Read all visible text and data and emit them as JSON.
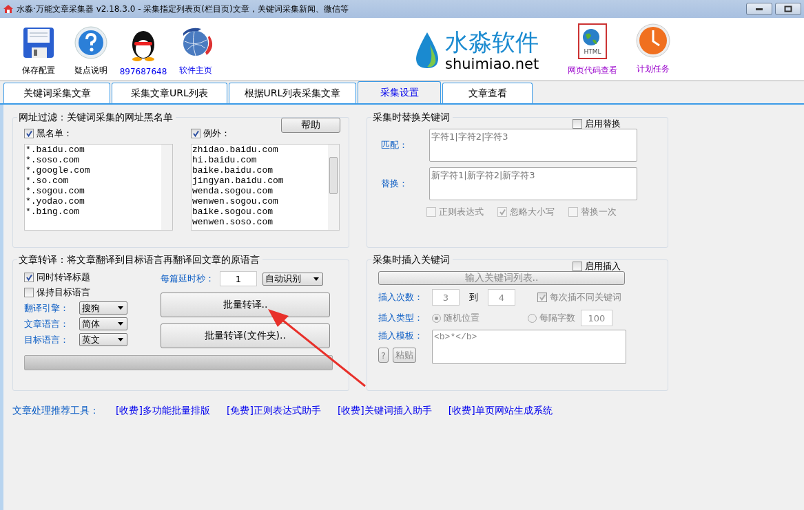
{
  "window": {
    "title": "水淼·万能文章采集器 v2.18.3.0 - 采集指定列表页(栏目页)文章，关键词采集新闻、微信等"
  },
  "toolbar": [
    {
      "label": "保存配置",
      "kind": "save",
      "link": false
    },
    {
      "label": "疑点说明",
      "kind": "help",
      "link": false
    },
    {
      "label": "897687648",
      "kind": "qq",
      "link": true
    },
    {
      "label": "软件主页",
      "kind": "web",
      "link": true
    }
  ],
  "logo": {
    "name": "水淼软件",
    "domain": "shuimiao.net"
  },
  "tools": [
    {
      "label": "网页代码查看",
      "kind": "html",
      "icon_text": "HTML"
    },
    {
      "label": "计划任务",
      "kind": "clock"
    }
  ],
  "tabs": [
    {
      "label": "关键词采集文章",
      "selected": false
    },
    {
      "label": "采集文章URL列表",
      "selected": false
    },
    {
      "label": "根据URL列表采集文章",
      "selected": false
    },
    {
      "label": "采集设置",
      "selected": true
    },
    {
      "label": "文章查看",
      "selected": false
    }
  ],
  "url_filter": {
    "title": "网址过滤：关键词采集的网址黑名单",
    "help_button": "帮助",
    "lists": [
      {
        "label": "黑名单：",
        "checked": true,
        "items": [
          "*.baidu.com",
          "*.soso.com",
          "*.google.com",
          "*.so.com",
          "*.sogou.com",
          "*.yodao.com",
          "*.bing.com"
        ]
      },
      {
        "label": "例外：",
        "checked": true,
        "items": [
          "zhidao.baidu.com",
          "hi.baidu.com",
          "baike.baidu.com",
          "jingyan.baidu.com",
          "wenda.sogou.com",
          "wenwen.sogou.com",
          "baike.sogou.com",
          "wenwen.soso.com"
        ]
      }
    ]
  },
  "replace": {
    "title": "采集时替换关键词",
    "enable": {
      "label": "启用替换",
      "checked": false
    },
    "fields": [
      {
        "label": "匹配：",
        "value": "字符1|字符2|字符3"
      },
      {
        "label": "替换：",
        "value": "新字符1|新字符2|新字符3"
      }
    ],
    "options": [
      {
        "label": "正则表达式",
        "checked": false,
        "disabled": true
      },
      {
        "label": "忽略大小写",
        "checked": true,
        "disabled": true
      },
      {
        "label": "替换一次",
        "checked": false,
        "disabled": true
      }
    ]
  },
  "translate": {
    "title": "文章转译：将文章翻译到目标语言再翻译回文章的原语言",
    "options": [
      {
        "label": "同时转译标题",
        "checked": true
      },
      {
        "label": "保持目标语言",
        "checked": false
      }
    ],
    "selects": [
      {
        "label": "翻译引擎：",
        "value": "搜狗"
      },
      {
        "label": "文章语言：",
        "value": "简体"
      },
      {
        "label": "目标语言：",
        "value": "英文"
      }
    ],
    "delay": {
      "label": "每篇延时秒：",
      "value": "1"
    },
    "detect": "自动识别",
    "buttons": [
      "批量转译..",
      "批量转译(文件夹).."
    ],
    "progress": {
      "level": 0
    }
  },
  "insert": {
    "title": "采集时插入关键词",
    "enable": {
      "label": "启用插入",
      "checked": false
    },
    "disabled": true,
    "list_button": "输入关键词列表..",
    "count": {
      "label": "插入次数：",
      "from": "3",
      "to_label": "到",
      "to": "4"
    },
    "different": {
      "label": "每次插不同关键词",
      "checked": true
    },
    "type": {
      "label": "插入类型：",
      "options": [
        {
          "label": "随机位置",
          "selected": true
        },
        {
          "label": "每隔字数",
          "selected": false
        }
      ],
      "interval": "100"
    },
    "template": {
      "label": "插入模板：",
      "value": "<b>*</b>",
      "help_button": "?",
      "paste_button": "粘贴"
    }
  },
  "recommend": {
    "label": "文章处理推荐工具：",
    "links": [
      "[收费]多功能批量排版",
      "[免费]正则表达式助手",
      "[收费]关键词插入助手",
      "[收费]单页网站生成系统"
    ]
  }
}
